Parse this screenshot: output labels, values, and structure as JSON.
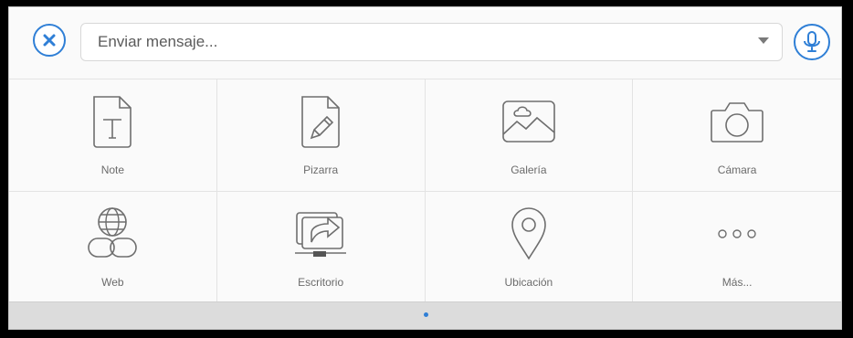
{
  "composer": {
    "input_placeholder": "Enviar mensaje...",
    "input_value": ""
  },
  "tiles": [
    {
      "label": "Note",
      "icon": "note-icon"
    },
    {
      "label": "Pizarra",
      "icon": "whiteboard-icon"
    },
    {
      "label": "Galería",
      "icon": "gallery-icon"
    },
    {
      "label": "Cámara",
      "icon": "camera-icon"
    },
    {
      "label": "Web",
      "icon": "web-link-icon"
    },
    {
      "label": "Escritorio",
      "icon": "screen-share-icon"
    },
    {
      "label": "Ubicación",
      "icon": "location-pin-icon"
    },
    {
      "label": "Más...",
      "icon": "more-dots-icon"
    }
  ],
  "colors": {
    "accent": "#2f7fd6",
    "icon_stroke": "#6e6e6e",
    "label": "#6b6b6b"
  }
}
